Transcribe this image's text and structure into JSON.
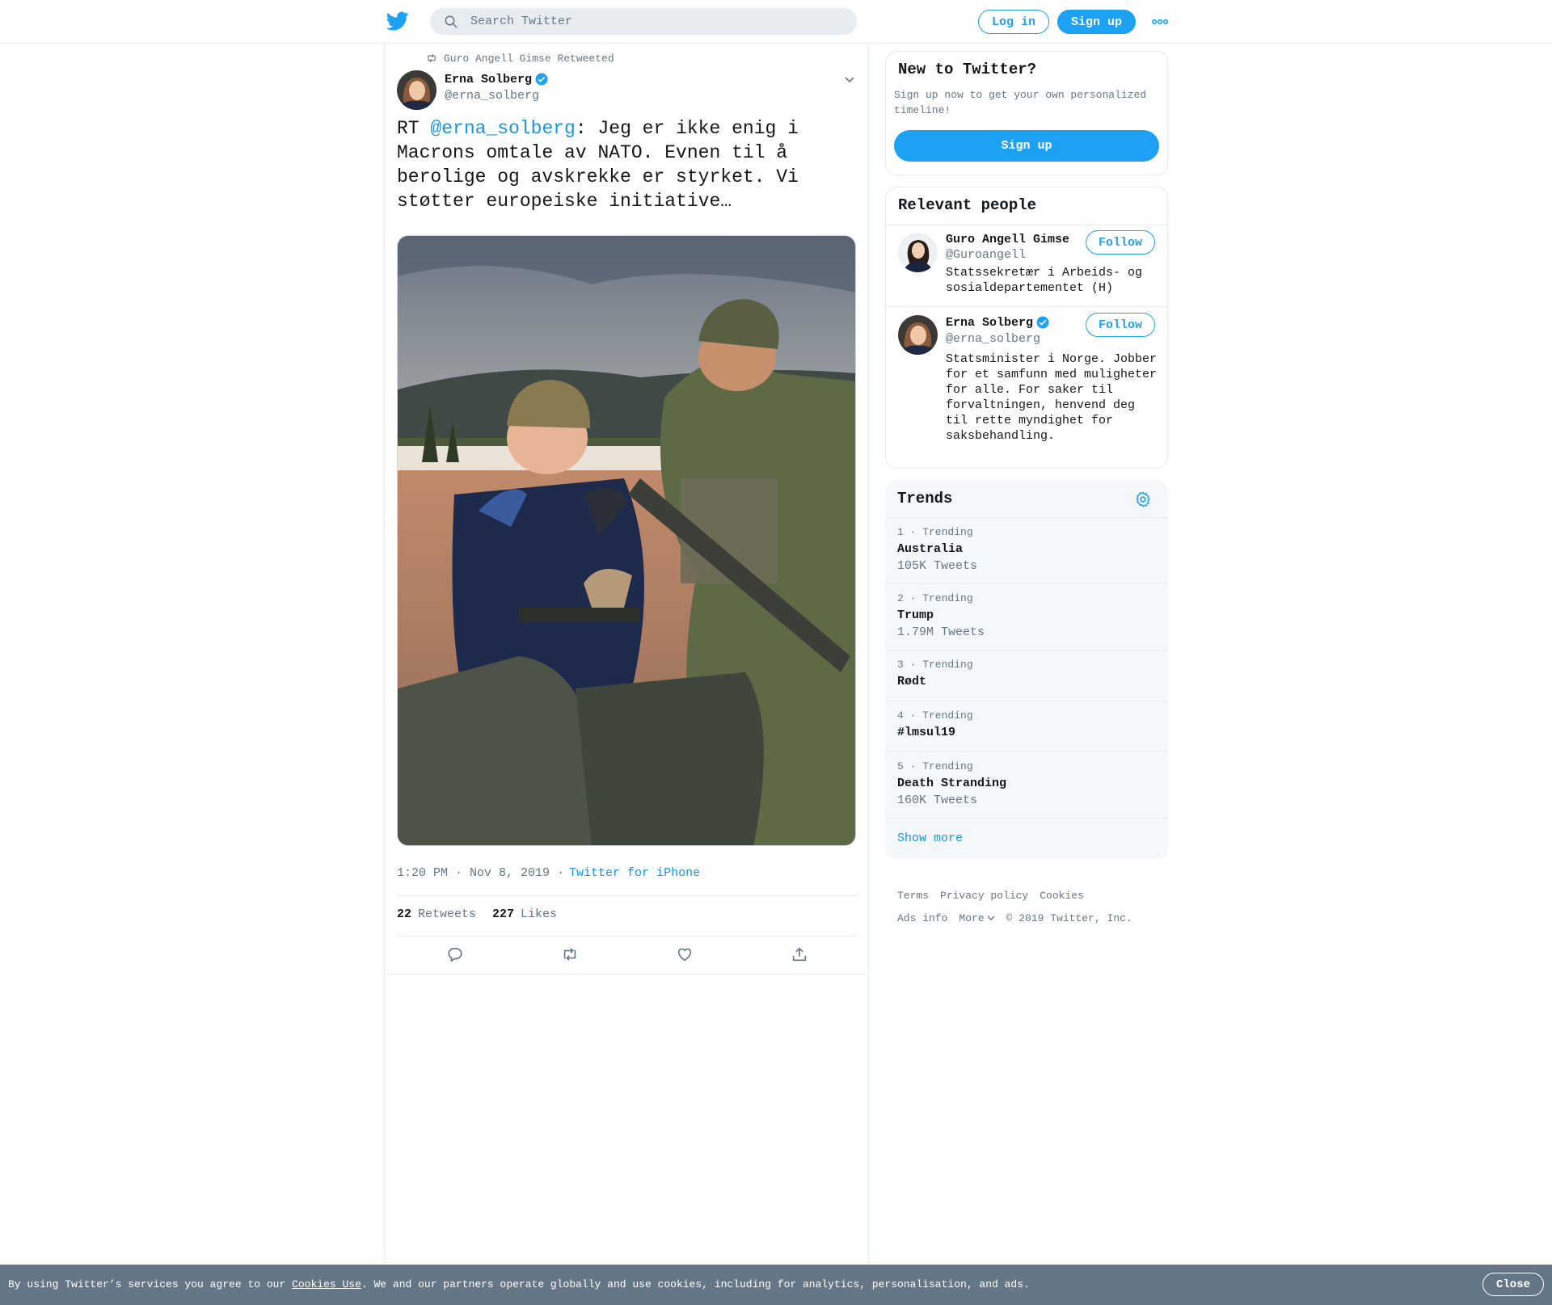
{
  "header": {
    "search_placeholder": "Search Twitter",
    "login_label": "Log in",
    "signup_label": "Sign up",
    "brand_color": "#1da1f2"
  },
  "tweet": {
    "retweeted_by": "Guro Angell Gimse Retweeted",
    "author_name": "Erna Solberg",
    "author_handle": "@erna_solberg",
    "text_prefix": "RT ",
    "text_mention": "@erna_solberg",
    "text_body": ": Jeg er ikke enig i Macrons omtale av NATO. Evnen til å berolige og avskrekke er styrket. Vi støtter europeiske initiative…",
    "timestamp": "1:20 PM · Nov 8, 2019 ·",
    "source": "Twitter for iPhone",
    "retweets_count": "22",
    "retweets_label": "Retweets",
    "likes_count": "227",
    "likes_label": "Likes"
  },
  "sidebar": {
    "new_to": {
      "title": "New to Twitter?",
      "description": "Sign up now to get your own personalized timeline!",
      "signup_label": "Sign up"
    },
    "relevant": {
      "title": "Relevant people",
      "people": [
        {
          "name": "Guro Angell Gimse",
          "handle": "@Guroangell",
          "bio": "Statssekretær i Arbeids- og sosialdepartementet (H)",
          "follow_label": "Follow"
        },
        {
          "name": "Erna Solberg",
          "handle": "@erna_solberg",
          "bio": "Statsminister i Norge. Jobber for et samfunn med muligheter for alle. For saker til forvaltningen, henvend deg til rette myndighet for saksbehandling.",
          "follow_label": "Follow"
        }
      ]
    },
    "trends": {
      "title": "Trends",
      "items": [
        {
          "meta": "1 · Trending",
          "name": "Australia",
          "count": "105K Tweets"
        },
        {
          "meta": "2 · Trending",
          "name": "Trump",
          "count": "1.79M Tweets"
        },
        {
          "meta": "3 · Trending",
          "name": "Rødt",
          "count": ""
        },
        {
          "meta": "4 · Trending",
          "name": "#lmsul19",
          "count": ""
        },
        {
          "meta": "5 · Trending",
          "name": "Death Stranding",
          "count": "160K Tweets"
        }
      ],
      "show_more": "Show more"
    },
    "footer": {
      "terms": "Terms",
      "privacy": "Privacy policy",
      "cookies": "Cookies",
      "ads_info": "Ads info",
      "more": "More",
      "copyright": "© 2019 Twitter, Inc."
    }
  },
  "cookie_bar": {
    "text_before": "By using Twitter’s services you agree to our ",
    "link": "Cookies Use",
    "text_after": ". We and our partners operate globally and use cookies, including for analytics, personalisation, and ads.",
    "close_label": "Close"
  }
}
